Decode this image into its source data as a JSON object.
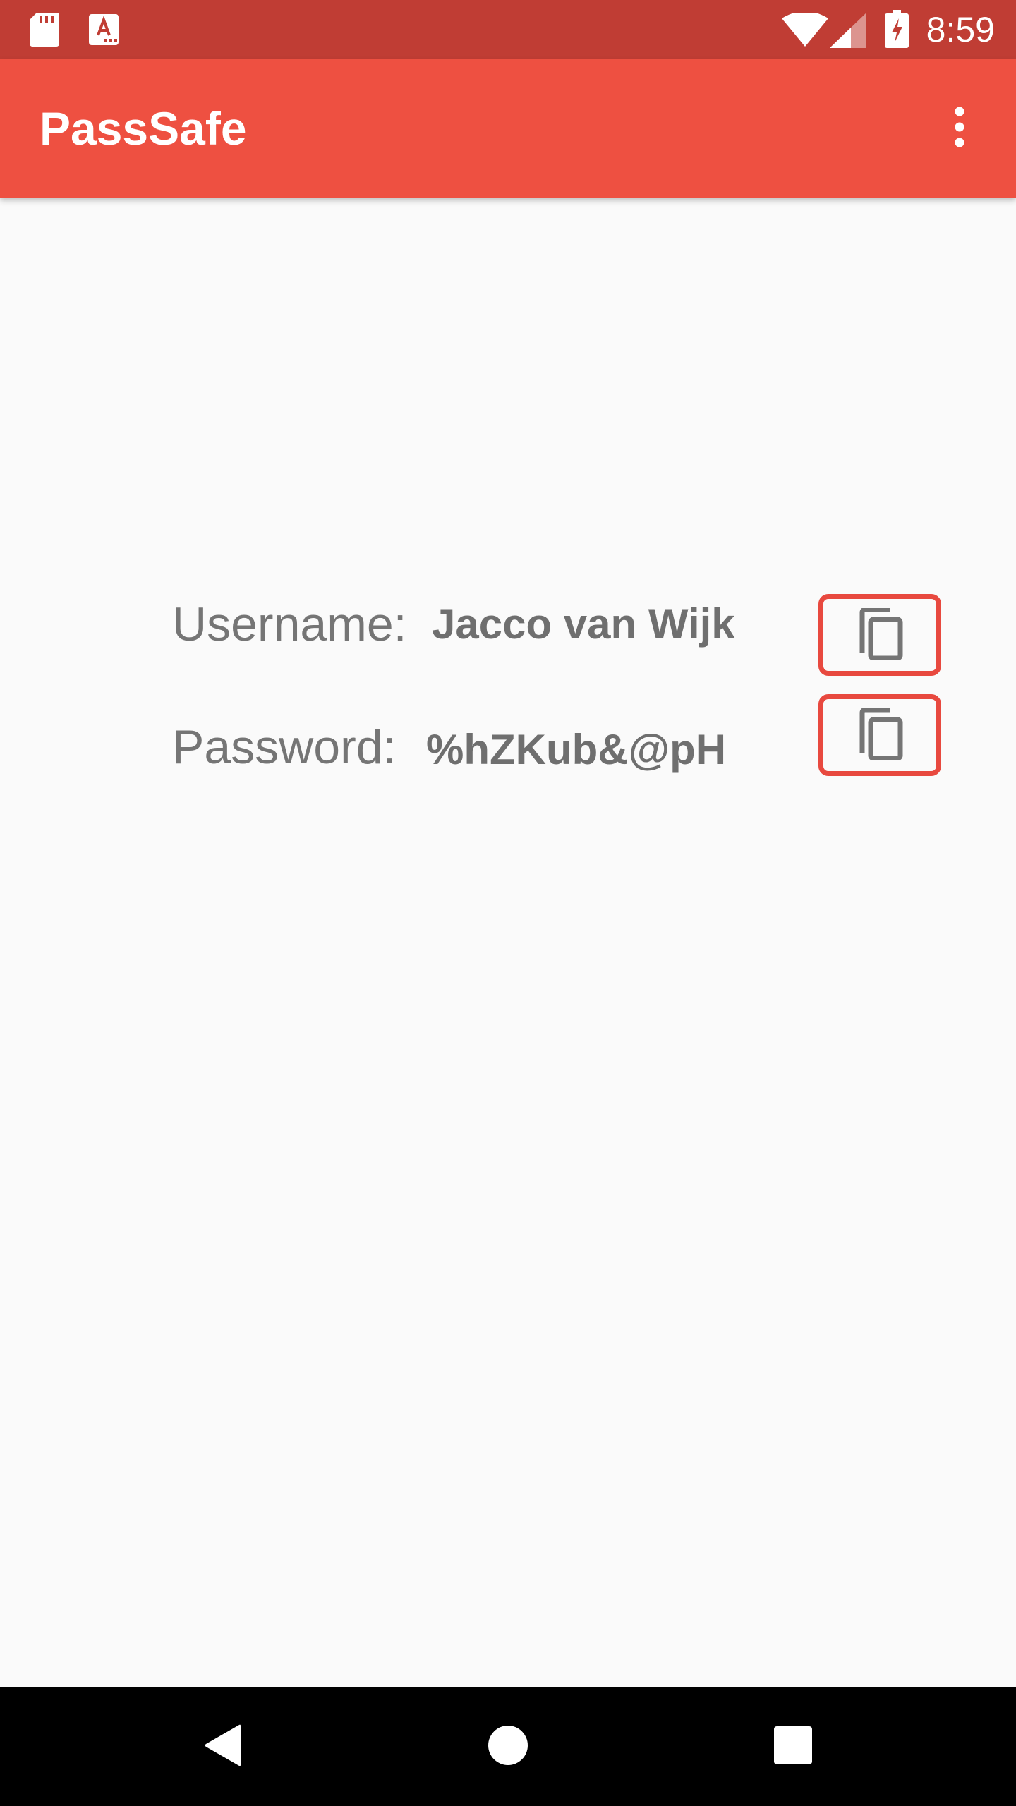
{
  "status_bar": {
    "time": "8:59",
    "left_icons": [
      "sd-card-icon",
      "keyboard-a-icon"
    ],
    "right_icons": [
      "wifi-icon",
      "signal-icon",
      "battery-charging-icon"
    ]
  },
  "app_bar": {
    "title": "PassSafe",
    "overflow_icon": "more-vert-icon"
  },
  "credentials": {
    "username_label": "Username:",
    "username_value": "Jacco van Wijk",
    "password_label": "Password:",
    "password_value": "%hZKub&@pH",
    "copy_icon": "copy-icon"
  },
  "nav_bar": {
    "back_icon": "back-icon",
    "home_icon": "home-icon",
    "recents_icon": "recents-icon"
  },
  "colors": {
    "status_bar": "#c03d34",
    "app_bar": "#ee5041",
    "accent_border": "#e8493f",
    "text_gray": "#757575",
    "background": "#fafafa"
  }
}
